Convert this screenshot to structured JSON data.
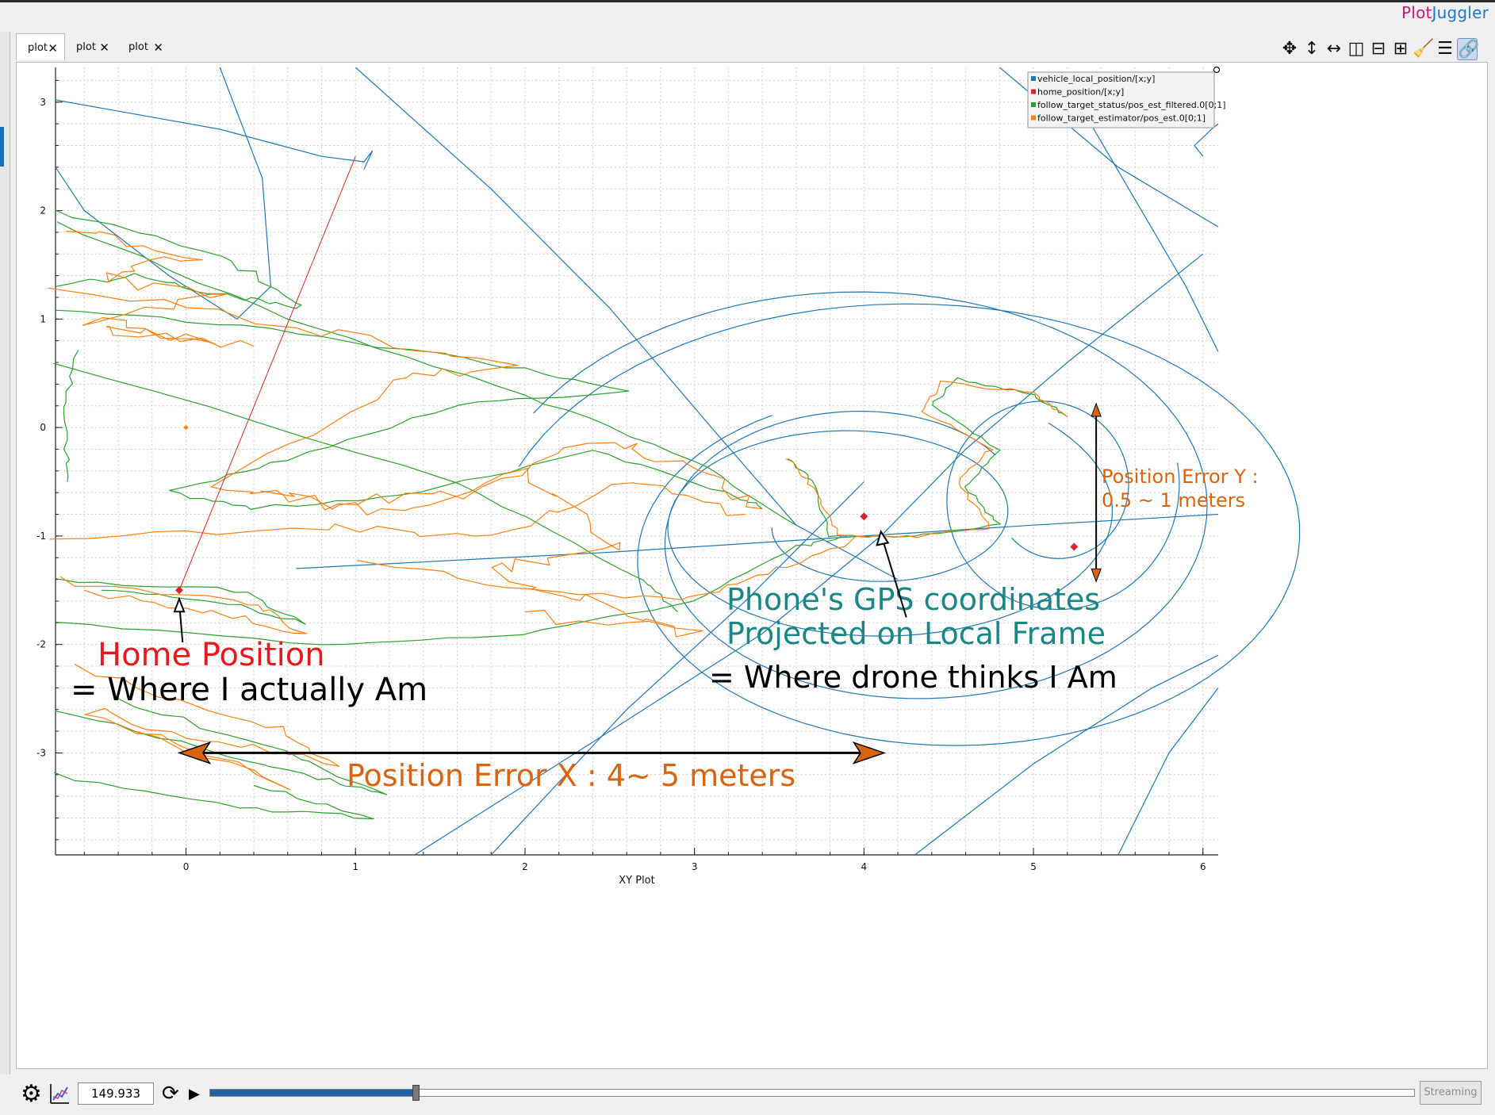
{
  "app": {
    "brand_part1": "Plot",
    "brand_part2": "Juggler"
  },
  "tabs": [
    {
      "label": "plot",
      "close": "✕",
      "active": true
    },
    {
      "label": "plot",
      "close": "✕",
      "active": false
    },
    {
      "label": "plot",
      "close": "✕",
      "active": false
    }
  ],
  "toolbar": {
    "icons": [
      "move-icon",
      "zoom-vertical-icon",
      "zoom-horizontal-icon",
      "split-horizontal-icon",
      "split-vertical-icon",
      "add-plot-icon",
      "clear-icon",
      "legend-icon",
      "link-icon"
    ],
    "glyphs": [
      "✥",
      "↕",
      "↔",
      "◫",
      "⊟",
      "⊞",
      "🧹",
      "☰",
      "🔗"
    ]
  },
  "colors": {
    "vehicle": "#1f77b4",
    "home": "#d62728",
    "filtered": "#2ca02c",
    "estimator": "#ff7f0e",
    "annot_red": "#e8191e",
    "annot_teal": "#1a8786",
    "annot_orange": "#d9640f"
  },
  "chart_data": {
    "type": "scatter",
    "xlabel": "XY Plot",
    "ylabel": "",
    "title": "",
    "xlim": [
      -0.77,
      6.09
    ],
    "ylim": [
      -3.94,
      3.32
    ],
    "xticks": [
      0,
      1,
      2,
      3,
      4,
      5,
      6
    ],
    "yticks": [
      3,
      2,
      1,
      0,
      -1,
      -2,
      -3
    ],
    "grid": true,
    "legend_position": "top-right",
    "series": [
      {
        "name": "vehicle_local_position/[x;y]",
        "color": "#1f77b4"
      },
      {
        "name": "home_position/[x;y]",
        "color": "#d62728",
        "points": [
          [
            -0.04,
            -1.5
          ],
          [
            5.24,
            -1.1
          ],
          [
            4.0,
            -0.82
          ]
        ]
      },
      {
        "name": "follow_target_status/pos_est_filtered.0[0;1]",
        "color": "#2ca02c"
      },
      {
        "name": "follow_target_estimator/pos_est.0[0;1]",
        "color": "#ff7f0e",
        "points": [
          [
            0.0,
            0.0
          ]
        ]
      }
    ],
    "annotations": [
      {
        "text": "Home Position",
        "color": "#e8191e"
      },
      {
        "text": "= Where I actually Am",
        "color": "#000000"
      },
      {
        "text": "Phone's GPS coordinates",
        "color": "#1a8786"
      },
      {
        "text": "Projected on Local Frame",
        "color": "#1a8786"
      },
      {
        "text": "= Where drone thinks I Am",
        "color": "#000000"
      },
      {
        "text": "Position Error X : 4~ 5 meters",
        "color": "#d9640f"
      },
      {
        "text": "Position Error Y :",
        "color": "#d9640f"
      },
      {
        "text": "0.5 ~ 1 meters",
        "color": "#d9640f"
      }
    ]
  },
  "bottom": {
    "time_value": "149.933",
    "progress": 0.17,
    "streaming_label": "Streaming"
  }
}
